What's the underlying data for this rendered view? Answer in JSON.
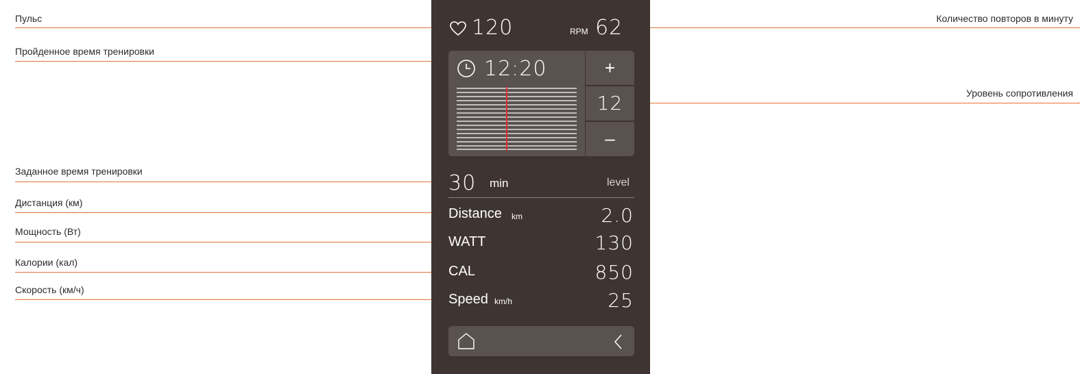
{
  "annotations": {
    "pulse": "Пульс",
    "elapsed_time": "Пройденное время тренировки",
    "set_time": "Заданное время тренировки",
    "distance": "Дистанция (км)",
    "power": "Мощность (Вт)",
    "calories": "Калории (кал)",
    "speed": "Скорость (км/ч)",
    "rpm": "Количество повторов в минуту",
    "resistance": "Уровень сопротивления"
  },
  "display": {
    "heart_rate": "120",
    "rpm_label": "RPM",
    "rpm_value": "62",
    "elapsed": "12:20",
    "plus": "+",
    "level_value": "12",
    "minus": "–",
    "target_minutes": "30",
    "min_unit": "min",
    "level_label": "level",
    "distance_label": "Distance",
    "distance_unit": "km",
    "distance_value": "2.0",
    "watt_label": "WATT",
    "watt_value": "130",
    "cal_label": "CAL",
    "cal_value": "850",
    "speed_label": "Speed",
    "speed_unit": "km/h",
    "speed_value": "25"
  },
  "icons": [
    "heart-icon",
    "clock-icon",
    "home-icon",
    "back-chevron-icon"
  ],
  "colors": {
    "panel": "#3e3431",
    "tile": "#5a524f",
    "leader": "#e0733a",
    "progress_marker": "#e03030"
  }
}
